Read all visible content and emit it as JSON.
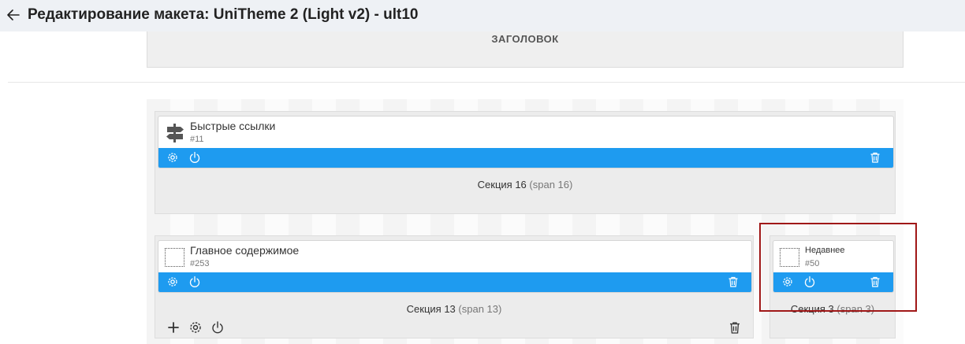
{
  "window": {
    "title": "Редактирование макета: UniTheme 2 (Light v2) - ult10"
  },
  "header_grid": {
    "label": "ЗАГОЛОВОК"
  },
  "sections": [
    {
      "name": "Секция 16",
      "span": "(span 16)",
      "blocks": [
        {
          "title": "Быстрые ссылки",
          "id": "#11",
          "icon": "signpost-icon"
        }
      ]
    },
    {
      "name": "Секция 13",
      "span": "(span 13)",
      "blocks": [
        {
          "title": "Главное содержимое",
          "id": "#253",
          "icon": "dotted-placeholder-icon"
        }
      ]
    },
    {
      "name": "Секция 3",
      "span": "(span 3)",
      "blocks": [
        {
          "title": "Недавнее",
          "id": "#50",
          "icon": "dotted-placeholder-icon"
        }
      ]
    }
  ],
  "colors": {
    "accent": "#1e9bf0",
    "highlight": "#a01818",
    "topbar": "#eef1f5"
  }
}
